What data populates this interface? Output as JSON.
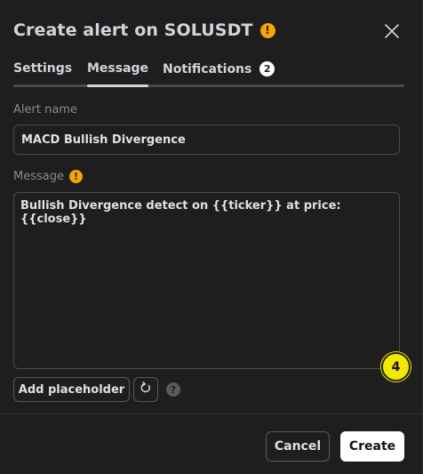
{
  "header": {
    "title": "Create alert on SOLUSDT",
    "warn_icon_glyph": "!"
  },
  "tabs": [
    {
      "label": "Settings",
      "active": false
    },
    {
      "label": "Message",
      "active": true
    },
    {
      "label": "Notifications",
      "active": false,
      "badge": "2"
    }
  ],
  "alert_name": {
    "label": "Alert name",
    "value": "MACD Bullish Divergence"
  },
  "message": {
    "label": "Message",
    "warn_icon_glyph": "!",
    "value": "Bullish Divergence detect on {{ticker}} at price: {{close}}"
  },
  "step_badge": "4",
  "actions": {
    "add_placeholder_label": "Add placeholder",
    "help_glyph": "?"
  },
  "footer": {
    "cancel_label": "Cancel",
    "create_label": "Create"
  },
  "colors": {
    "accent_warning": "#f7a600",
    "step_badge": "#f5e800",
    "background": "#1e1e1e"
  },
  "icons": {
    "close": "close-icon",
    "reset": "reset-icon",
    "help": "help-icon",
    "warning": "warning-icon"
  }
}
